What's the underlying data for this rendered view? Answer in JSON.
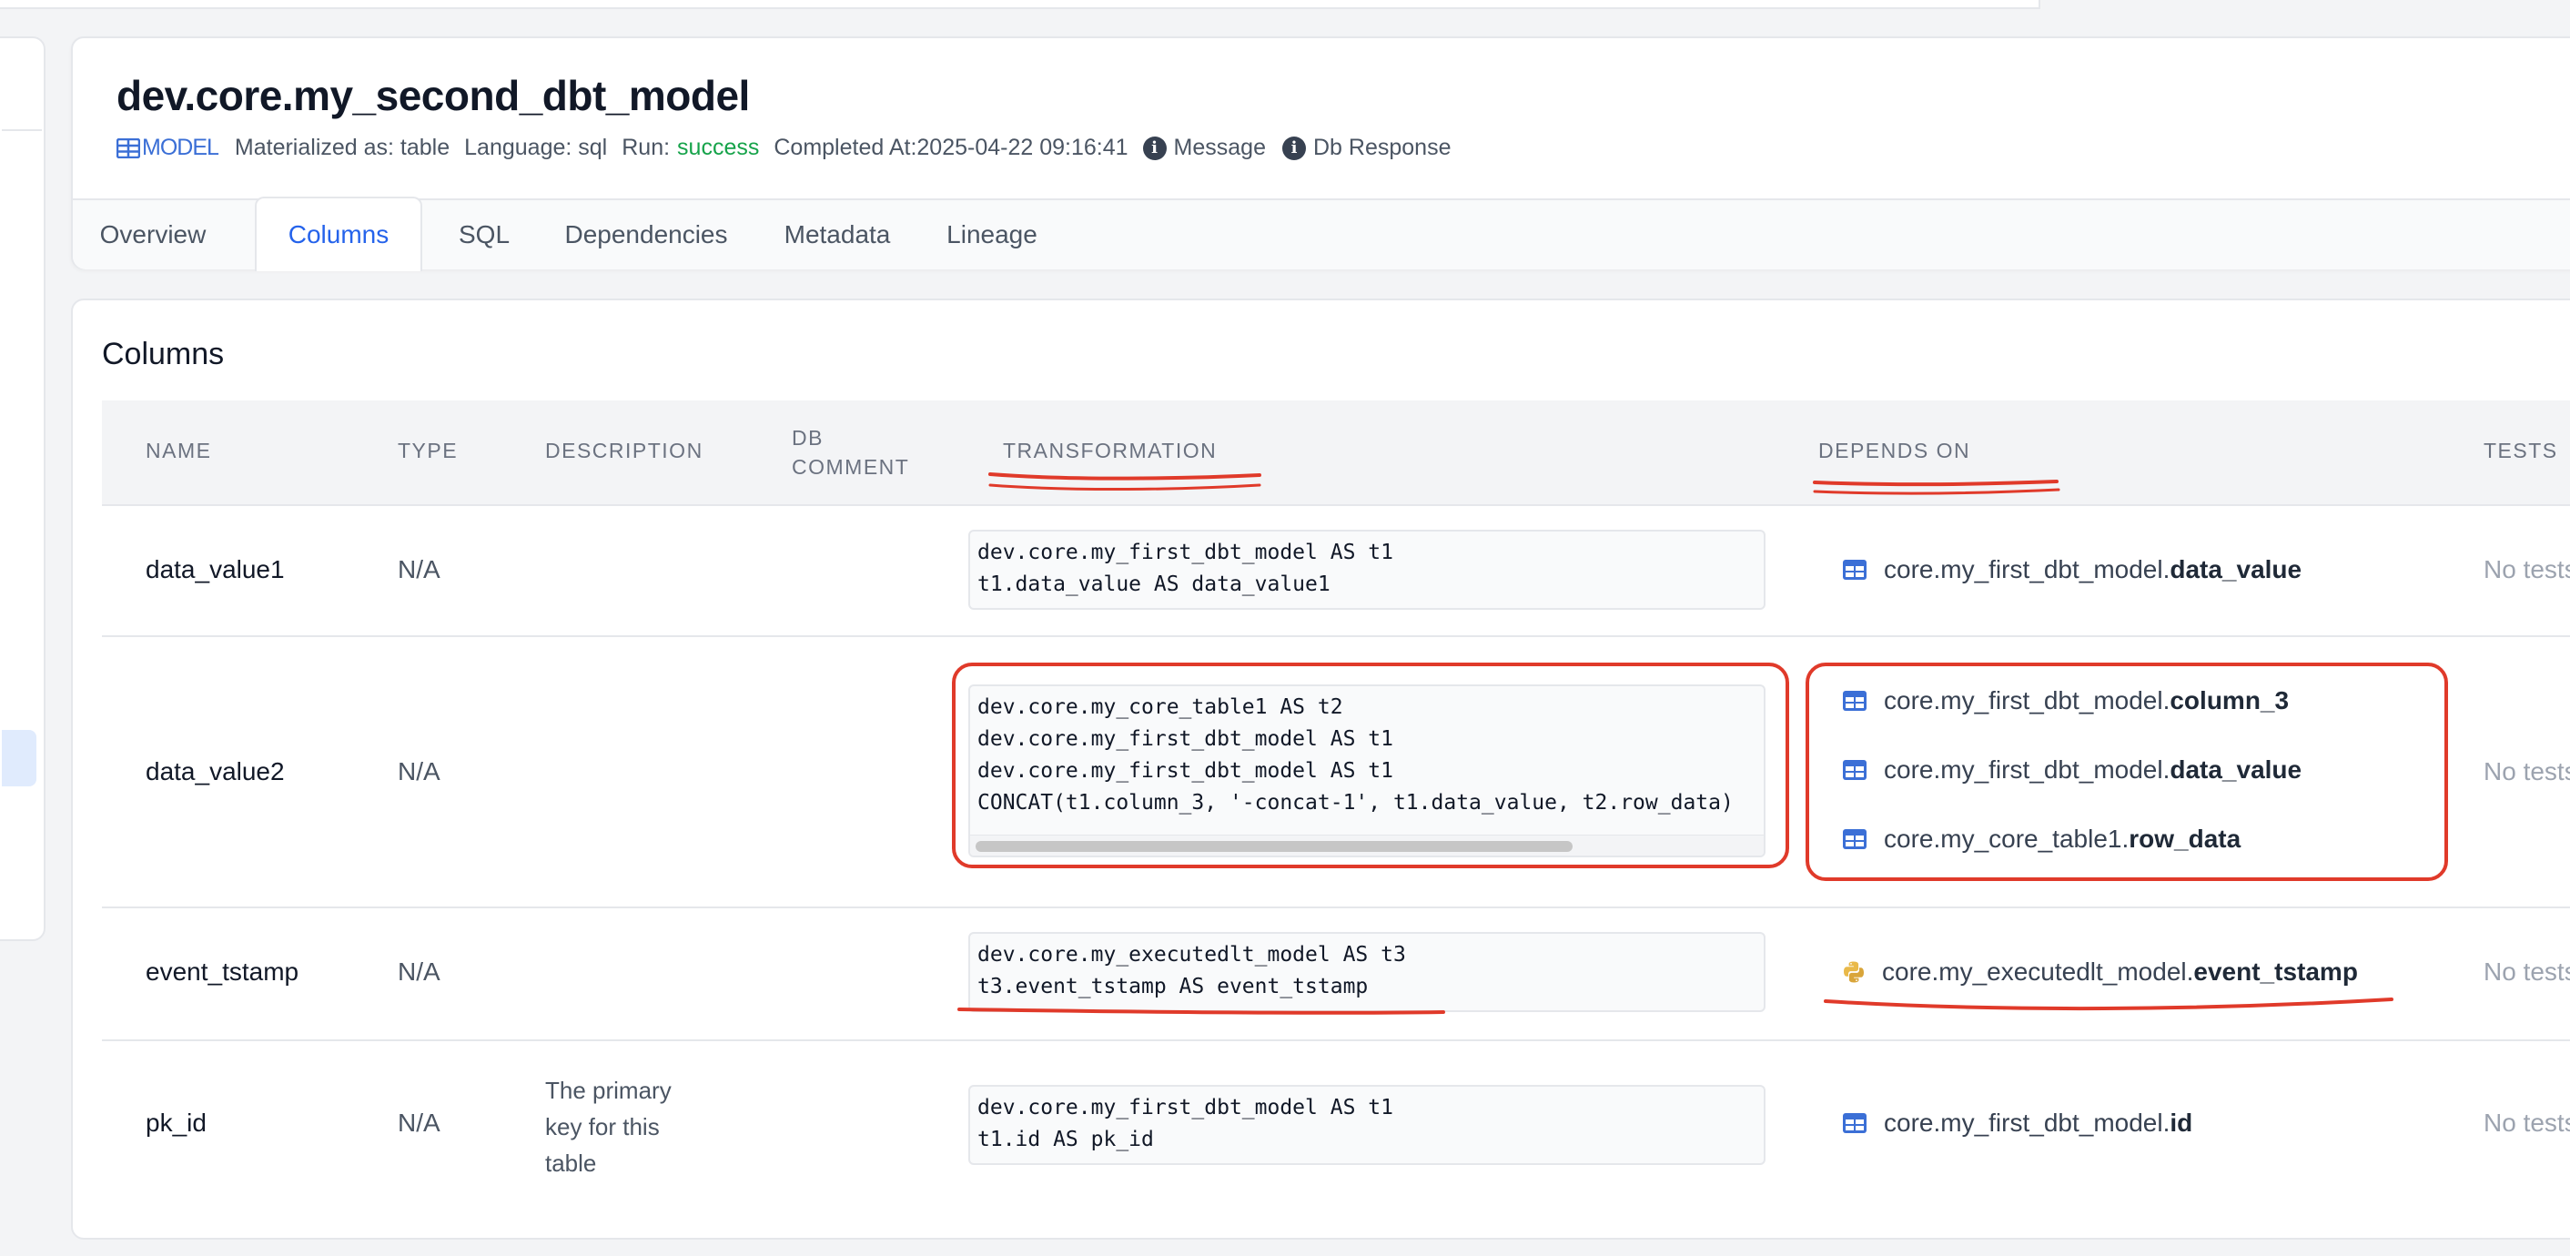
{
  "model": {
    "title": "dev.core.my_second_dbt_model",
    "badge": "MODEL",
    "materialized": "Materialized as: table",
    "language": "Language: sql",
    "run_label": "Run:",
    "run_status": "success",
    "completed": "Completed At:2025-04-22 09:16:41",
    "message": "Message",
    "db_response": "Db Response"
  },
  "tabs": [
    "Overview",
    "Columns",
    "SQL",
    "Dependencies",
    "Metadata",
    "Lineage"
  ],
  "active_tab": "Columns",
  "columns_section": {
    "title": "Columns",
    "headers": {
      "name": "NAME",
      "type": "TYPE",
      "description": "DESCRIPTION",
      "db_comment_1": "DB",
      "db_comment_2": "COMMENT",
      "transformation": "TRANSFORMATION",
      "depends_on": "DEPENDS ON",
      "tests": "TESTS"
    },
    "rows": [
      {
        "name": "data_value1",
        "type": "N/A",
        "description": "",
        "transformation": [
          "dev.core.my_first_dbt_model AS t1",
          "t1.data_value AS data_value1"
        ],
        "depends_on": [
          {
            "icon": "table-icon",
            "prefix": "core.my_first_dbt_model.",
            "column": "data_value"
          }
        ],
        "tests": "No tests"
      },
      {
        "name": "data_value2",
        "type": "N/A",
        "description": "",
        "transformation": [
          "dev.core.my_core_table1 AS t2",
          "dev.core.my_first_dbt_model AS t1",
          "dev.core.my_first_dbt_model AS t1",
          "CONCAT(t1.column_3, '-concat-1', t1.data_value, t2.row_data)"
        ],
        "depends_on": [
          {
            "icon": "table-icon",
            "prefix": "core.my_first_dbt_model.",
            "column": "column_3"
          },
          {
            "icon": "table-icon",
            "prefix": "core.my_first_dbt_model.",
            "column": "data_value"
          },
          {
            "icon": "table-icon",
            "prefix": "core.my_core_table1.",
            "column": "row_data"
          }
        ],
        "tests": "No tests"
      },
      {
        "name": "event_tstamp",
        "type": "N/A",
        "description": "",
        "transformation": [
          "dev.core.my_executedlt_model AS t3",
          "t3.event_tstamp AS event_tstamp"
        ],
        "depends_on": [
          {
            "icon": "python-icon",
            "prefix": "core.my_executedlt_model.",
            "column": "event_tstamp"
          }
        ],
        "tests": "No tests"
      },
      {
        "name": "pk_id",
        "type": "N/A",
        "description": [
          "The primary",
          "key for this",
          "table"
        ],
        "transformation": [
          "dev.core.my_first_dbt_model AS t1",
          "t1.id AS pk_id"
        ],
        "depends_on": [
          {
            "icon": "table-icon",
            "prefix": "core.my_first_dbt_model.",
            "column": "id"
          }
        ],
        "tests": "No tests"
      }
    ]
  },
  "colors": {
    "accent": "#2563eb",
    "success": "#16a34a",
    "annotation": "#e03a2a",
    "table_icon": "#3b6fd6",
    "python_icon": "#e9b949"
  }
}
